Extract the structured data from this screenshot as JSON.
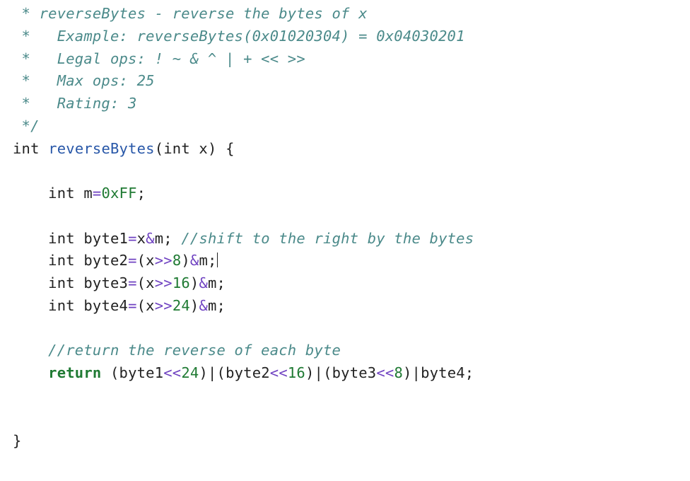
{
  "comment": {
    "l1": " * reverseBytes - reverse the bytes of x",
    "l2": " *   Example: reverseBytes(0x01020304) = 0x04030201",
    "l3": " *   Legal ops: ! ~ & ^ | + << >>",
    "l4": " *   Max ops: 25",
    "l5": " *   Rating: 3",
    "l6": " */"
  },
  "sig": {
    "ret": "int",
    "name": "reverseBytes",
    "open": "(",
    "ptype": "int",
    "pname": " x",
    "close": ") {"
  },
  "m": {
    "decl": "int",
    "name": " m",
    "eq": "=",
    "val": "0xFF",
    "semi": ";"
  },
  "b1": {
    "decl": "int",
    "name": " byte1",
    "eq": "=",
    "x": "x",
    "amp": "&",
    "m": "m",
    "semi": ";",
    "cmt": " //shift to the right by the bytes"
  },
  "b2": {
    "decl": "int",
    "name": " byte2",
    "eq": "=",
    "lp": "(",
    "x": "x",
    "shr": ">>",
    "n": "8",
    "rp": ")",
    "amp": "&",
    "m": "m",
    "semi": ";"
  },
  "b3": {
    "decl": "int",
    "name": " byte3",
    "eq": "=",
    "lp": "(",
    "x": "x",
    "shr": ">>",
    "n": "16",
    "rp": ")",
    "amp": "&",
    "m": "m",
    "semi": ";"
  },
  "b4": {
    "decl": "int",
    "name": " byte4",
    "eq": "=",
    "lp": "(",
    "x": "x",
    "shr": ">>",
    "n": "24",
    "rp": ")",
    "amp": "&",
    "m": "m",
    "semi": ";"
  },
  "retcmt": "//return the reverse of each byte",
  "ret": {
    "kw": "return",
    "sp": " ",
    "lp1": "(",
    "b1": "byte1",
    "shl1": "<<",
    "n24": "24",
    "rp1": ")",
    "or1": "|",
    "lp2": "(",
    "b2": "byte2",
    "shl2": "<<",
    "n16": "16",
    "rp2": ")",
    "or2": "|",
    "lp3": "(",
    "b3": "byte3",
    "shl3": "<<",
    "n8": "8",
    "rp3": ")",
    "or3": "|",
    "b4": "byte4",
    "semi": ";"
  },
  "close": "}",
  "indent": "    "
}
